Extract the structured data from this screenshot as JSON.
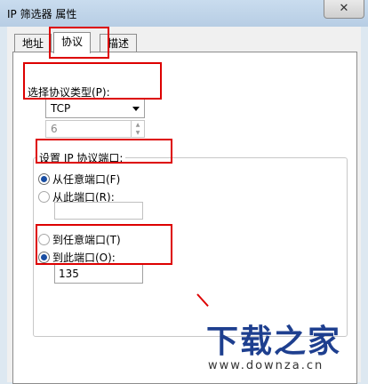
{
  "window": {
    "title": "IP 筛选器 属性",
    "close_glyph": "✕"
  },
  "tabs": [
    {
      "label": "地址",
      "active": false
    },
    {
      "label": "协议",
      "active": true
    },
    {
      "label": "描述",
      "active": false
    }
  ],
  "protocol": {
    "type_label": "选择协议类型(P):",
    "selected_type": "TCP",
    "number_value": "6"
  },
  "ports": {
    "group_label": "设置 IP 协议端口:",
    "source": {
      "any_label": "从任意端口(F)",
      "this_label": "从此端口(R):",
      "selected": "any",
      "value": ""
    },
    "destination": {
      "any_label": "到任意端口(T)",
      "this_label": "到此端口(O):",
      "selected": "this",
      "value": "135"
    }
  },
  "watermark": {
    "logo_text": "下载之家",
    "url": "www.downza.cn"
  },
  "colors": {
    "highlight": "#dd0000",
    "radio_selected": "#1a4ea3",
    "watermark": "#1e3f8f"
  }
}
